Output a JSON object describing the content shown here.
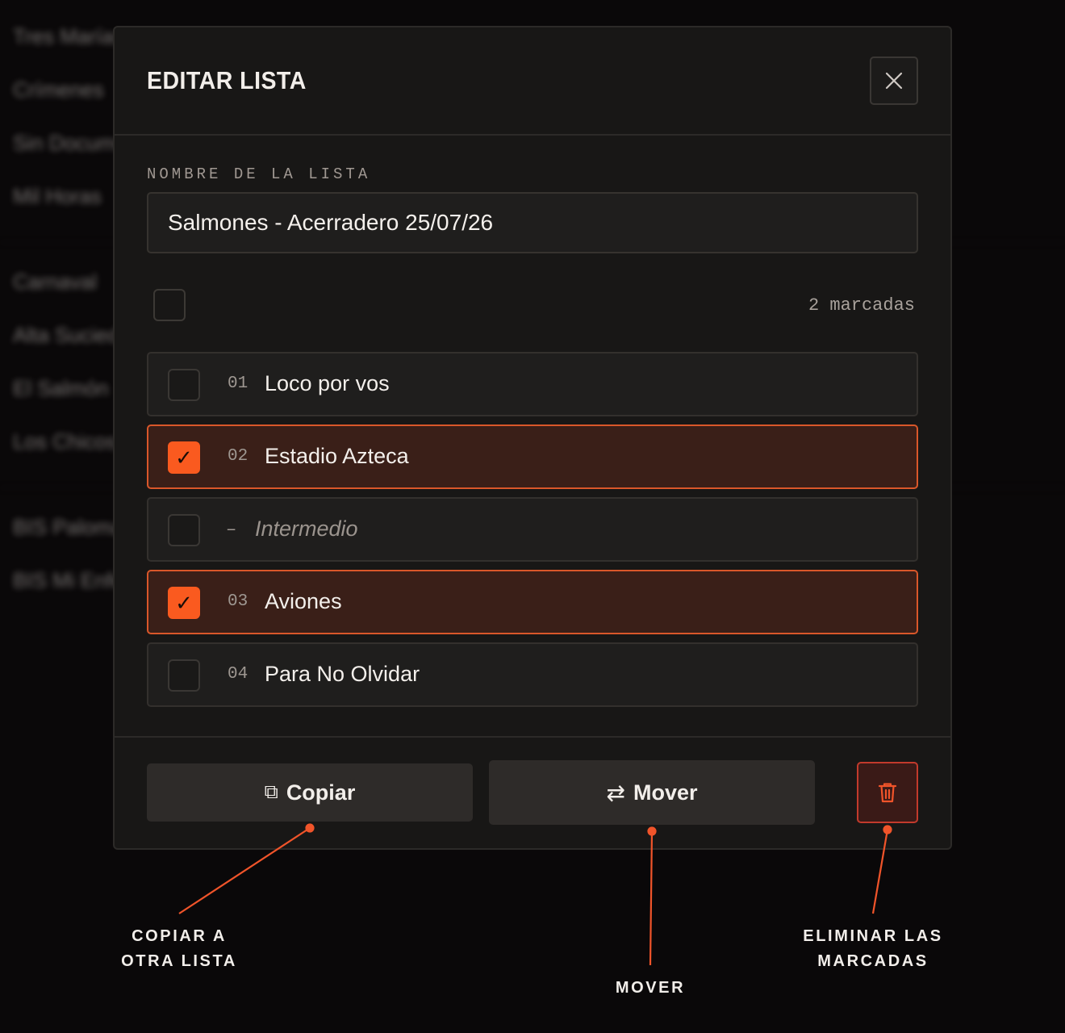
{
  "background_list": {
    "items": [
      "Tres Marías",
      "Crímenes",
      "Sin Documentos",
      "Mil Horas",
      "Carnaval",
      "Alta Suciedad",
      "El Salmón",
      "Los Chicos",
      "BIS Palomas",
      "BIS Mi Enfermedad"
    ]
  },
  "modal": {
    "title": "EDITAR LISTA",
    "close_label": "×",
    "name_label": "NOMBRE DE LA LISTA",
    "name_value": "Salmones - Acerradero 25/07/26",
    "marked_count": "2 marcadas",
    "rows": [
      {
        "num": "01",
        "title": "Loco por vos",
        "checked": false,
        "interlude": false
      },
      {
        "num": "02",
        "title": "Estadio Azteca",
        "checked": true,
        "interlude": false
      },
      {
        "num": "–",
        "title": "Intermedio",
        "checked": false,
        "interlude": true
      },
      {
        "num": "03",
        "title": "Aviones",
        "checked": true,
        "interlude": false
      },
      {
        "num": "04",
        "title": "Para No Olvidar",
        "checked": false,
        "interlude": false
      }
    ],
    "check_glyph": "✓",
    "copy_label": "Copiar",
    "copy_icon": "⧉",
    "move_label": "Mover",
    "move_icon": "⇄",
    "delete_icon": "trash-icon"
  },
  "annotations": {
    "copy": [
      "COPIAR A",
      "OTRA LISTA"
    ],
    "move": [
      "MOVER"
    ],
    "delete": [
      "ELIMINAR LAS",
      "MARCADAS"
    ]
  },
  "colors": {
    "accent": "#fa5a1f",
    "checked_row_bg": "#3a1f18",
    "delete_border": "#c23a2c"
  }
}
